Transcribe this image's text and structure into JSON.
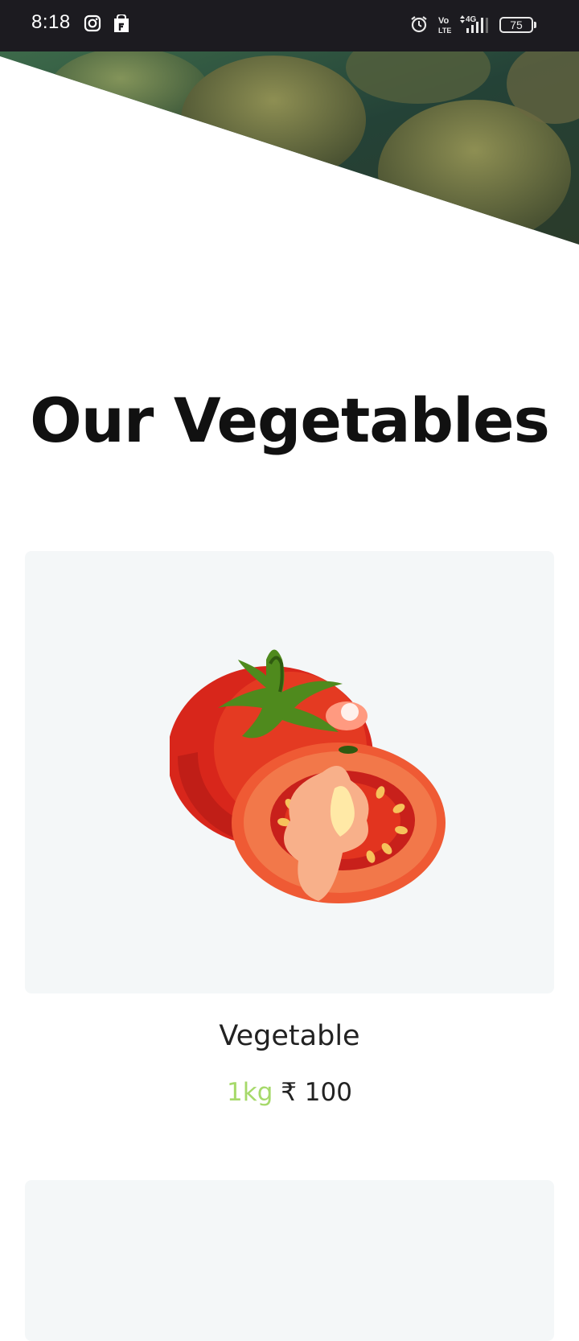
{
  "status_bar": {
    "time": "8:18",
    "battery": "75",
    "network": "4G",
    "volte": "Vo LTE",
    "icons": [
      "instagram-icon",
      "shop-icon",
      "alarm-icon",
      "volte-icon",
      "signal-icon",
      "battery-icon"
    ]
  },
  "hero": {
    "image": "vegetables-banner"
  },
  "page": {
    "title": "Our Vegetables"
  },
  "products": [
    {
      "image": "tomato-image",
      "name": "Vegetable",
      "unit": "1kg",
      "price": "₹ 100"
    }
  ],
  "colors": {
    "accent": "#a6d96a",
    "card_bg": "#f4f7f8",
    "status_bar": "#1c1b20"
  }
}
